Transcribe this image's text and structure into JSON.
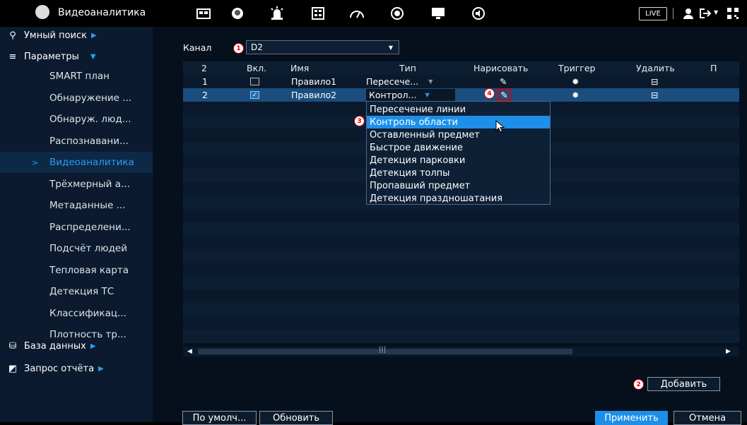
{
  "topbar": {
    "title": "Видеоаналитика",
    "live_label": "LIVE",
    "icons": [
      "monitor-icon",
      "face-icon",
      "alarm-icon",
      "calculator-icon",
      "speedometer-icon",
      "record-icon",
      "display-icon",
      "audio-icon"
    ]
  },
  "sidebar": {
    "smart_search": "Умный поиск",
    "parameters": "Параметры",
    "items": [
      "SMART план",
      "Обнаружение ...",
      "Обнаруж. люд...",
      "Распознавани...",
      "Видеоаналитика",
      "Трёхмерный а...",
      "Метаданные ...",
      "Распределени...",
      "Подсчёт людей",
      "Тепловая карта",
      "Детекция ТС",
      "Классификац...",
      "Плотность тр..."
    ],
    "active_index": 4,
    "database": "База данных",
    "report_query": "Запрос отчёта"
  },
  "channel": {
    "label": "Канал",
    "value": "D2",
    "badge": "1"
  },
  "table": {
    "headers": [
      "2",
      "Вкл.",
      "Имя",
      "Тип",
      "Нарисовать",
      "Триггер",
      "Удалить",
      "П"
    ],
    "rows": [
      {
        "num": "1",
        "enabled": false,
        "name": "Правило1",
        "type": "Пересече..."
      },
      {
        "num": "2",
        "enabled": true,
        "name": "Правило2",
        "type": "Контрол..."
      }
    ]
  },
  "dropdown": {
    "options": [
      "Пересечение линии",
      "Контроль области",
      "Оставленный предмет",
      "Быстрое движение",
      "Детекция парковки",
      "Детекция толпы",
      "Пропавший предмет",
      "Детекция праздношатания"
    ],
    "selected_index": 1,
    "badge": "3"
  },
  "draw_badge": "4",
  "add_badge": "2",
  "scrollbar_grip": "|||",
  "buttons": {
    "add": "Добавить",
    "default": "По умолч...",
    "refresh": "Обновить",
    "apply": "Применить",
    "cancel": "Отмена"
  },
  "colors": {
    "accent": "#1e8fe8",
    "badge_red": "#dd0000",
    "sidebar_bg": "#0b1a2e"
  }
}
